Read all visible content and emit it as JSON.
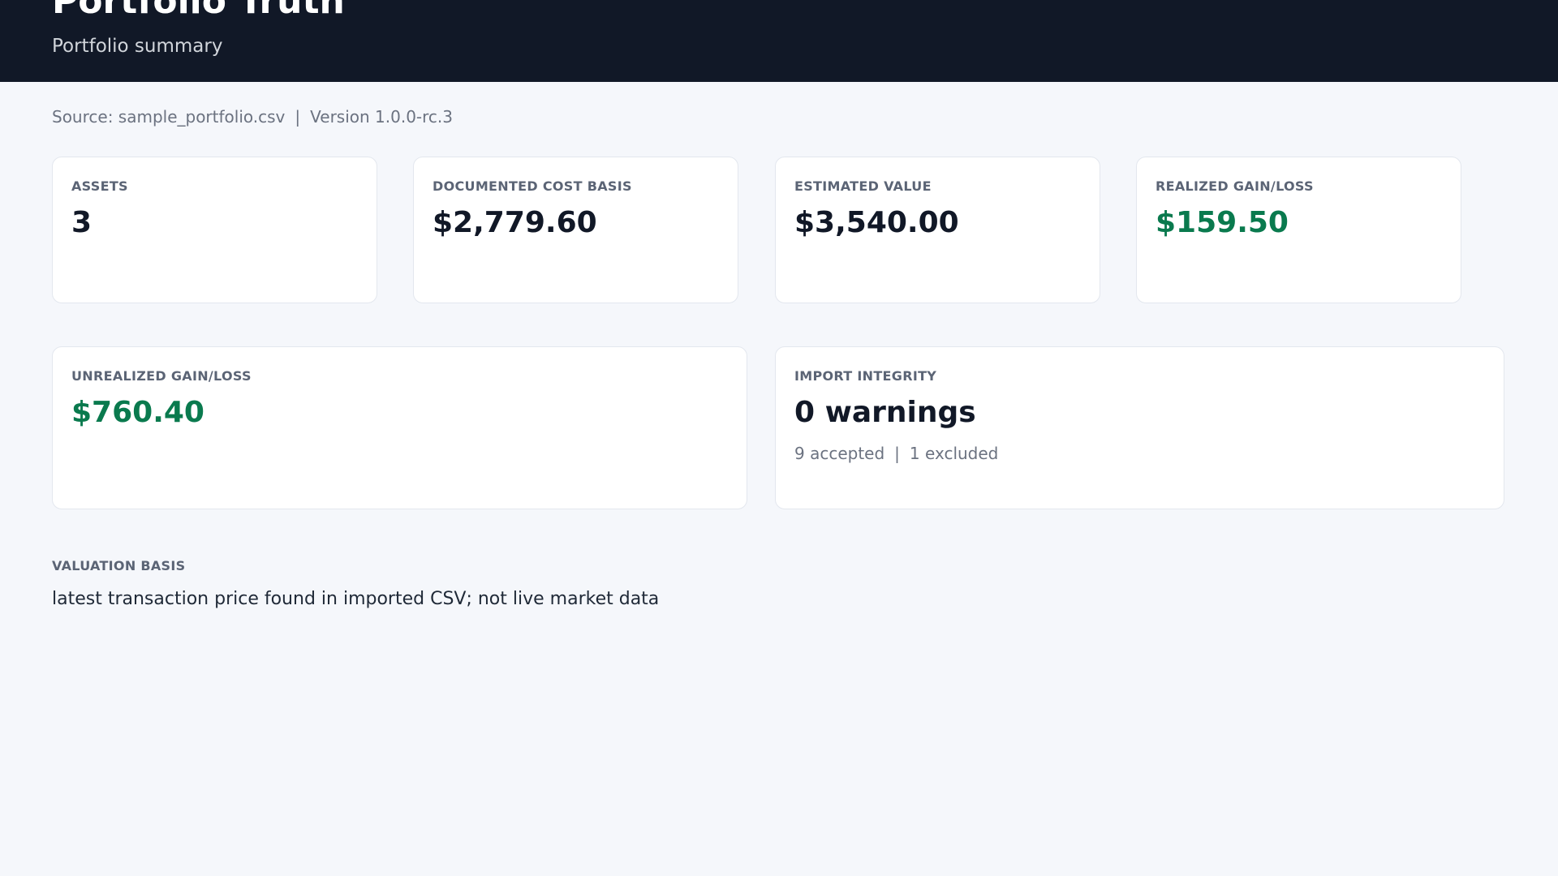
{
  "header": {
    "title": "Portfolio Truth",
    "subtitle": "Portfolio summary"
  },
  "meta": {
    "source": "Source: sample_portfolio.csv",
    "separator": "|",
    "version": "Version 1.0.0-rc.3"
  },
  "cards": {
    "assets": {
      "label": "ASSETS",
      "value": "3"
    },
    "cost_basis": {
      "label": "DOCUMENTED COST BASIS",
      "value": "$2,779.60"
    },
    "estimated_value": {
      "label": "ESTIMATED VALUE",
      "value": "$3,540.00"
    },
    "realized": {
      "label": "REALIZED GAIN/LOSS",
      "value": "$159.50"
    },
    "unrealized": {
      "label": "UNREALIZED GAIN/LOSS",
      "value": "$760.40"
    },
    "integrity": {
      "label": "IMPORT INTEGRITY",
      "value": "0 warnings",
      "accepted": "9 accepted",
      "separator": "|",
      "excluded": "1 excluded"
    }
  },
  "valuation": {
    "label": "VALUATION BASIS",
    "text": "latest transaction price found in imported CSV; not live market data"
  },
  "colors": {
    "header_bg": "#111827",
    "page_bg": "#f5f7fb",
    "positive": "#0a7a4e"
  }
}
